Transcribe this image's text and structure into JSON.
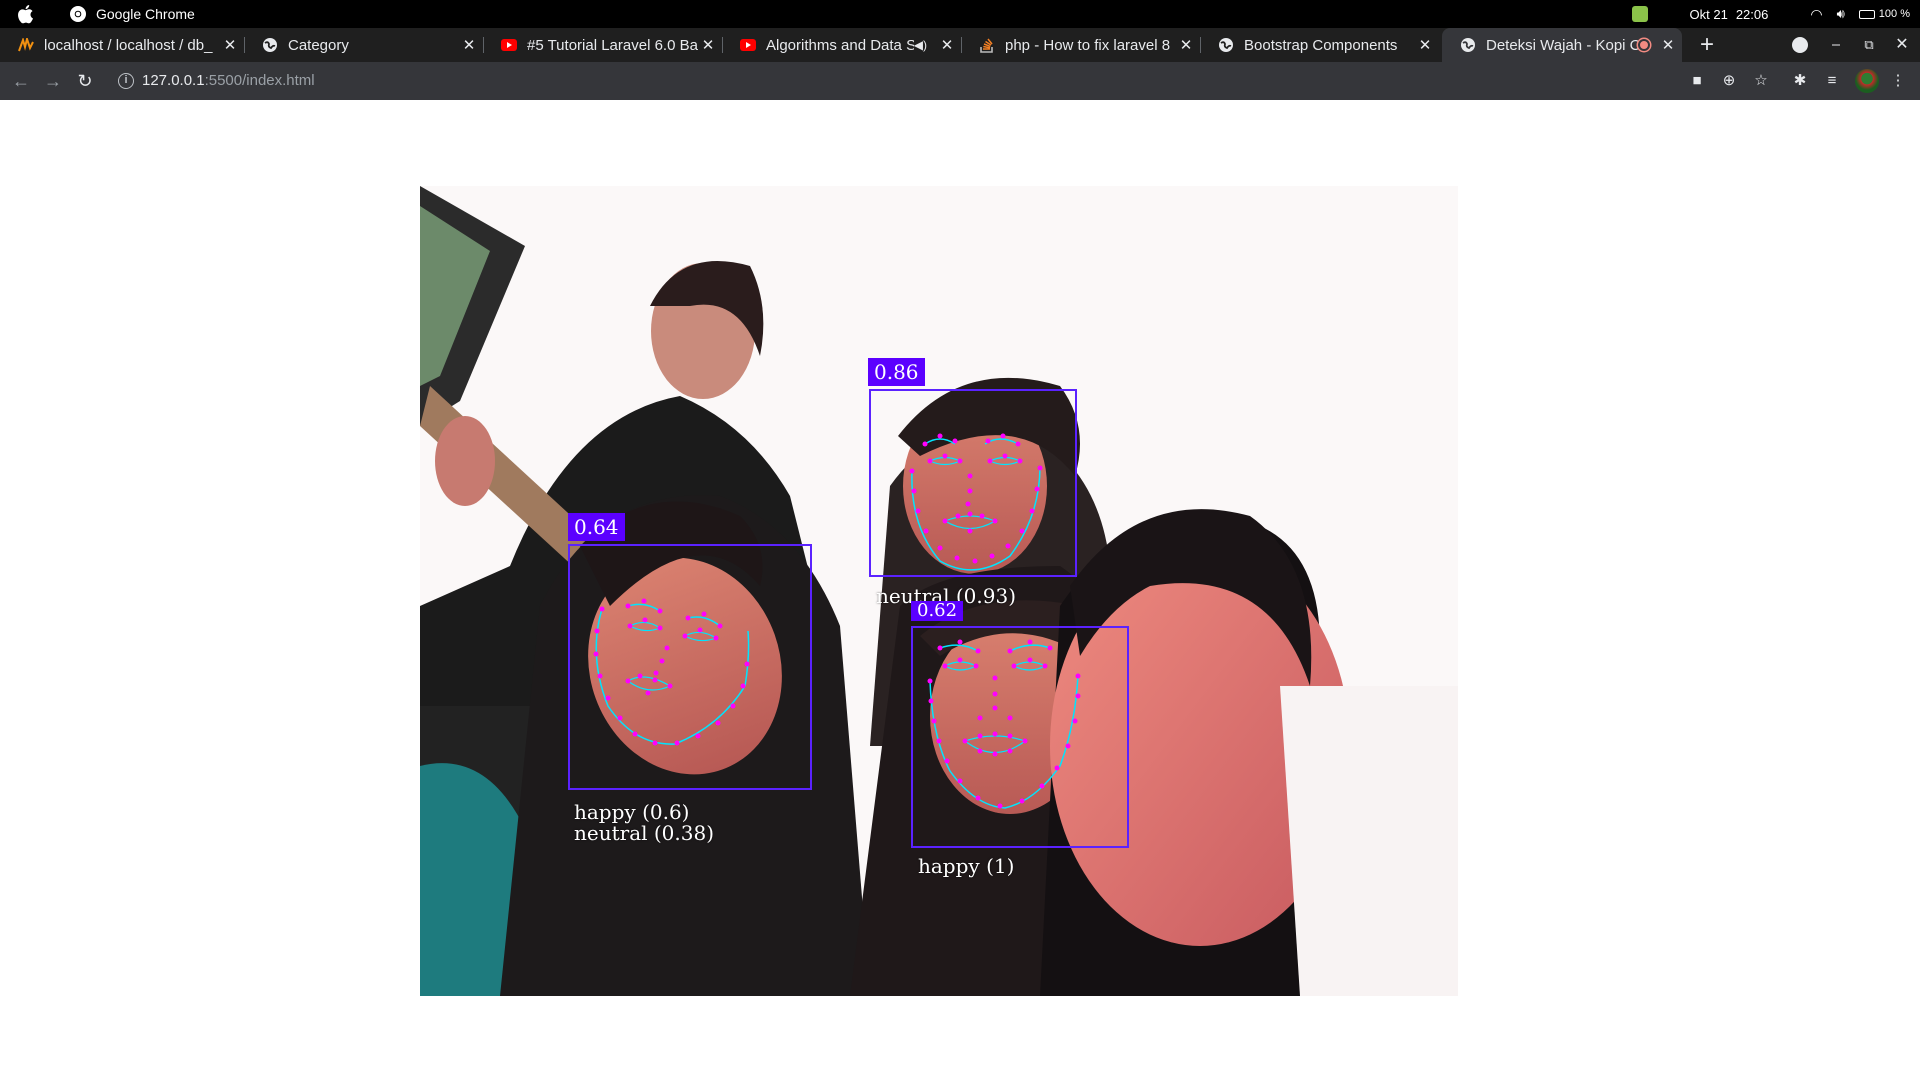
{
  "system_bar": {
    "app_name": "Google Chrome",
    "date": "Okt 21",
    "time": "22:06",
    "battery": "100 %"
  },
  "tabs": [
    {
      "title": "localhost / localhost / db_",
      "icon": "phpmyadmin-icon"
    },
    {
      "title": "Category",
      "icon": "globe-icon"
    },
    {
      "title": "#5 Tutorial Laravel 6.0 Ba",
      "icon": "youtube-icon"
    },
    {
      "title": "Algorithms and Data S",
      "icon": "youtube-icon"
    },
    {
      "title": "php - How to fix laravel 8",
      "icon": "stackoverflow-icon"
    },
    {
      "title": "Bootstrap Components",
      "icon": "globe-icon"
    },
    {
      "title": "Deteksi Wajah - Kopi C",
      "icon": "globe-icon",
      "active": true
    }
  ],
  "address_bar": {
    "host": "127.0.0.1",
    "path": ":5500/index.html"
  },
  "detections": [
    {
      "score": "0.86",
      "expressions": [
        "neutral (0.93)"
      ]
    },
    {
      "score": "0.64",
      "expressions": [
        "happy (0.6)",
        "neutral (0.38)"
      ]
    },
    {
      "score": "0.62",
      "expressions": [
        "happy (1)"
      ]
    }
  ],
  "colors": {
    "box": "#5b22ff",
    "landmarks": "#ff00ff",
    "contour": "#00e5ff"
  }
}
